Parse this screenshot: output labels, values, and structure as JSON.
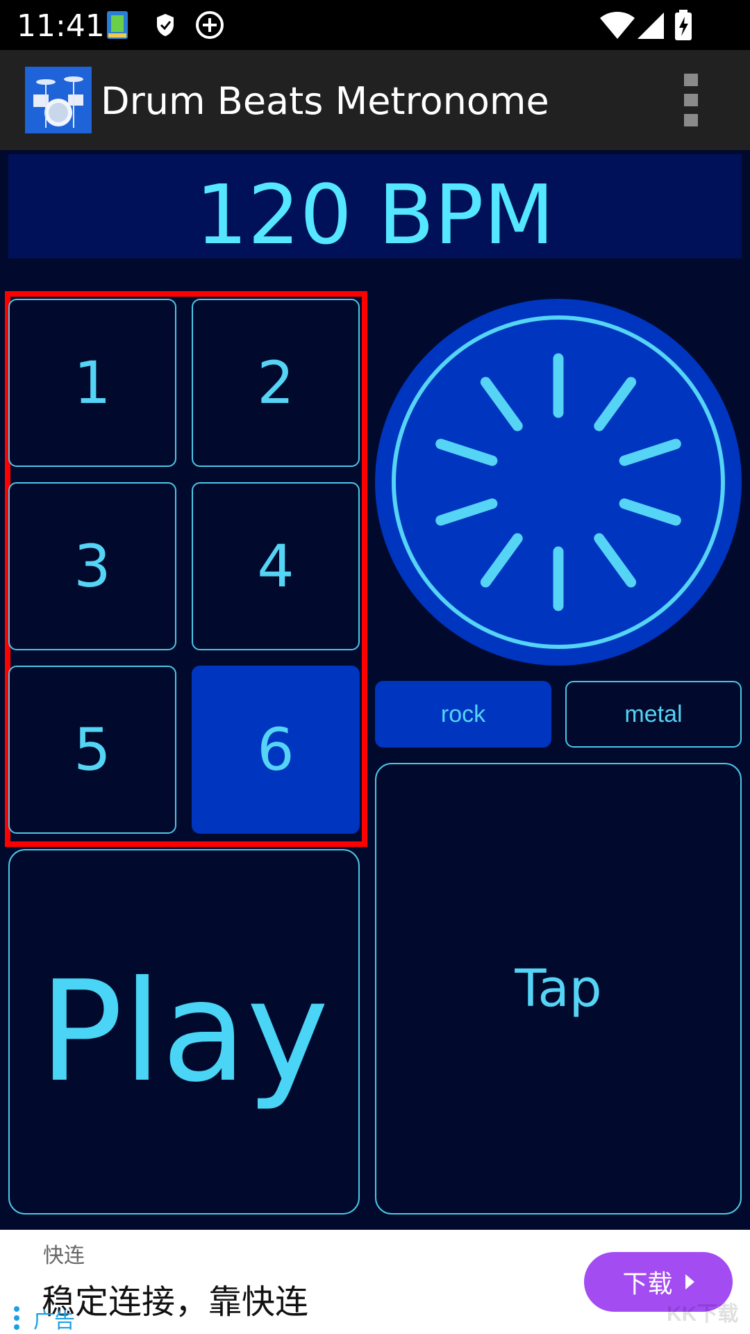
{
  "status_bar": {
    "time": "11:41"
  },
  "app_bar": {
    "title": "Drum Beats Metronome",
    "app_icon": "drum-kit-icon",
    "menu_icon": "more-vertical-icon"
  },
  "bpm": {
    "display": "120 BPM"
  },
  "beats": {
    "items": [
      {
        "label": "1",
        "active": false
      },
      {
        "label": "2",
        "active": false
      },
      {
        "label": "3",
        "active": false
      },
      {
        "label": "4",
        "active": false
      },
      {
        "label": "5",
        "active": false
      },
      {
        "label": "6",
        "active": true
      }
    ]
  },
  "styles": {
    "items": [
      {
        "label": "rock",
        "active": true
      },
      {
        "label": "metal",
        "active": false
      }
    ]
  },
  "controls": {
    "play_label": "Play",
    "tap_label": "Tap"
  },
  "ad": {
    "brand": "快连",
    "text": "稳定连接，靠快连",
    "label": "广告",
    "download_label": "下载",
    "watermark": "KK下载"
  },
  "colors": {
    "background": "#010a2c",
    "accent": "#55d4f5",
    "active_fill": "#0035c0",
    "highlight": "#ff0000",
    "ad_button": "#a24cf2"
  }
}
